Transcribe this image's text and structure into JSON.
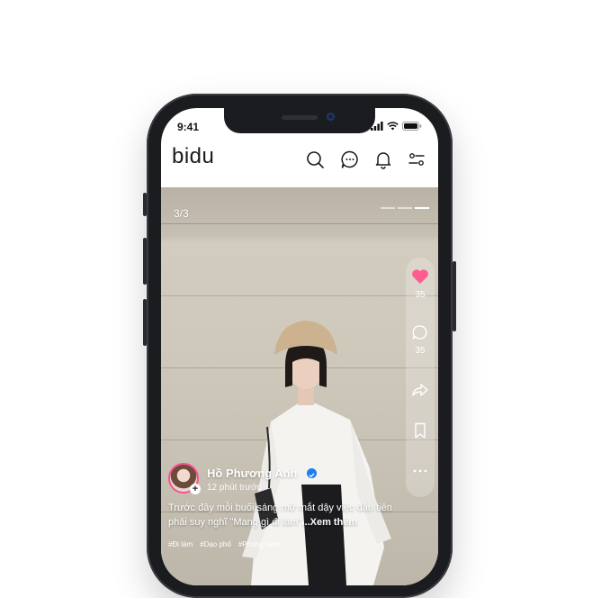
{
  "status_bar": {
    "time": "9:41"
  },
  "app": {
    "logo": "bidu",
    "icons": [
      "search-icon",
      "chat-icon",
      "bell-icon",
      "filter-icon"
    ]
  },
  "post": {
    "counter": "3/3",
    "likes": "35",
    "comments": "35",
    "user_name": "Hồ Phương Anh",
    "post_time": "12 phút trước",
    "caption": "Trước đây mỗi buổi sáng mở mắt dậy việc đầu tiên phải suy nghĩ \"Mang gì đi làm\"",
    "more_label": "...Xem thêm",
    "tags": [
      "#Đi làm",
      "#Dạo phố",
      "#Phong cách"
    ]
  },
  "colors": {
    "like": "#ff5c93",
    "verified": "#1e7cf2"
  }
}
